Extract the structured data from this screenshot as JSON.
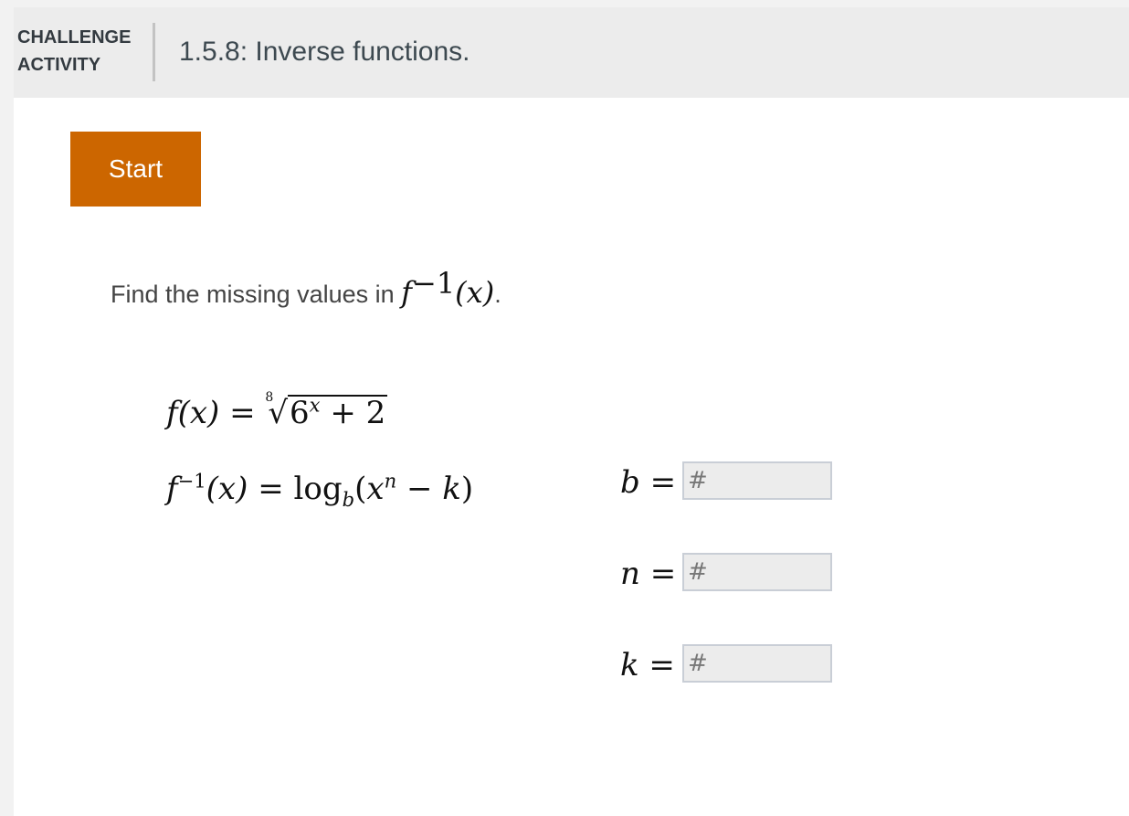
{
  "header": {
    "activity_type_line1": "CHALLENGE",
    "activity_type_line2": "ACTIVITY",
    "title": "1.5.8: Inverse functions."
  },
  "start_button": {
    "label": "Start"
  },
  "prompt": {
    "text": "Find the missing values in ",
    "math_f": "f",
    "math_exponent": "−1",
    "math_arg": "(x)",
    "end_punctuation": "."
  },
  "equations": {
    "f": {
      "lhs_f": "f",
      "lhs_arg": "(x)",
      "equals": " = ",
      "root_index": "8",
      "radicand_base": "6",
      "radicand_exponent": "x",
      "radicand_rest": " + 2"
    },
    "f_inverse": {
      "lhs_f": "f",
      "lhs_exponent": "−1",
      "lhs_arg": "(x)",
      "equals": " = ",
      "log": "log",
      "log_base": "b",
      "open_paren": "(",
      "var_x": "x",
      "exponent_n": "n",
      "minus": " − ",
      "var_k": "k",
      "close_paren": ")"
    }
  },
  "answers": [
    {
      "variable": "b",
      "equals": " =",
      "placeholder": "#",
      "value": ""
    },
    {
      "variable": "n",
      "equals": " =",
      "placeholder": "#",
      "value": ""
    },
    {
      "variable": "k",
      "equals": " =",
      "placeholder": "#",
      "value": ""
    }
  ],
  "colors": {
    "start_button": "#cc6600",
    "header_background": "#ececec",
    "input_background": "#ececec",
    "input_border": "#c9ced6"
  }
}
